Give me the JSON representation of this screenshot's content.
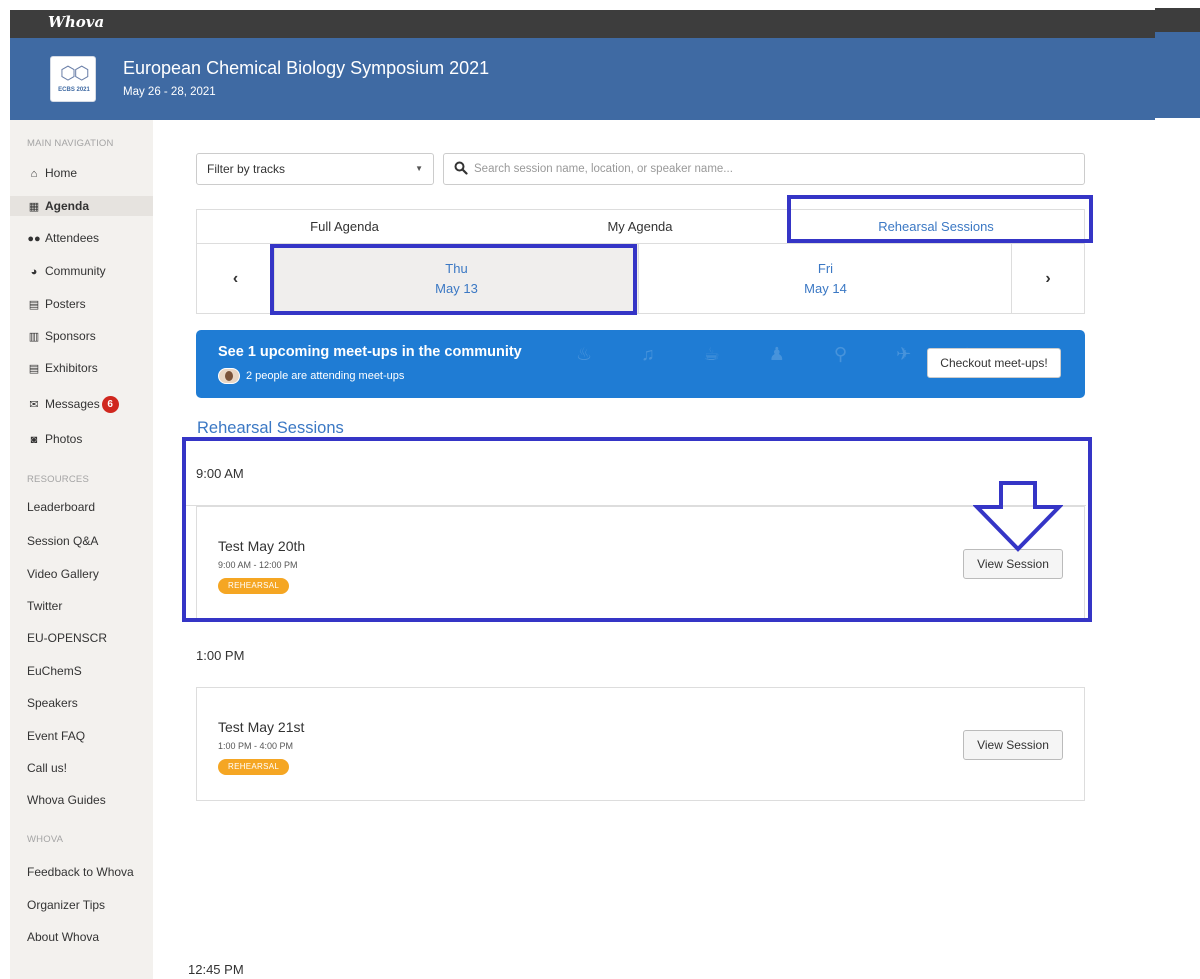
{
  "app": {
    "brand": "Whova"
  },
  "event": {
    "title": "European Chemical Biology Symposium 2021",
    "dates": "May 26 - 28, 2021",
    "logo_text": "ECBS 2021"
  },
  "sidebar": {
    "main_heading": "MAIN NAVIGATION",
    "items": [
      {
        "label": "Home",
        "icon": "home-icon"
      },
      {
        "label": "Agenda",
        "icon": "calendar-icon"
      },
      {
        "label": "Attendees",
        "icon": "users-icon"
      },
      {
        "label": "Community",
        "icon": "comments-icon"
      },
      {
        "label": "Posters",
        "icon": "poster-icon"
      },
      {
        "label": "Sponsors",
        "icon": "building-icon"
      },
      {
        "label": "Exhibitors",
        "icon": "booth-icon"
      },
      {
        "label": "Messages",
        "icon": "envelope-icon",
        "badge": "6"
      },
      {
        "label": "Photos",
        "icon": "camera-icon"
      }
    ],
    "resources_heading": "RESOURCES",
    "resources": [
      "Leaderboard",
      "Session Q&A",
      "Video Gallery",
      "Twitter",
      "EU-OPENSCR",
      "EuChemS",
      "Speakers",
      "Event FAQ",
      "Call us!",
      "Whova Guides"
    ],
    "whova_heading": "WHOVA",
    "whova_links": [
      "Feedback to Whova",
      "Organizer Tips",
      "About Whova"
    ]
  },
  "filters": {
    "tracks_label": "Filter by tracks",
    "search_placeholder": "Search session name, location, or speaker name..."
  },
  "tabs": [
    {
      "label": "Full Agenda"
    },
    {
      "label": "My Agenda"
    },
    {
      "label": "Rehearsal Sessions",
      "active": true
    }
  ],
  "days": [
    {
      "weekday": "Thu",
      "date": "May 13",
      "selected": true
    },
    {
      "weekday": "Fri",
      "date": "May 14"
    }
  ],
  "banner": {
    "title": "See 1 upcoming meet-ups in the community",
    "subtitle": "2 people are attending meet-ups",
    "button": "Checkout meet-ups!"
  },
  "section_title": "Rehearsal Sessions",
  "slots": [
    {
      "time": "9:00 AM",
      "session": {
        "name": "Test May 20th",
        "time": "9:00 AM - 12:00 PM",
        "tag": "REHEARSAL",
        "button": "View Session"
      }
    },
    {
      "time": "1:00 PM",
      "session": {
        "name": "Test May 21st",
        "time": "1:00 PM - 4:00 PM",
        "tag": "REHEARSAL",
        "button": "View Session"
      }
    }
  ],
  "footer_time": "12:45 PM",
  "colors": {
    "header": "#3f6aa3",
    "accent": "#3b78c4",
    "banner": "#1f7cd4",
    "tag": "#f5a623",
    "annotation": "#3535c6"
  }
}
